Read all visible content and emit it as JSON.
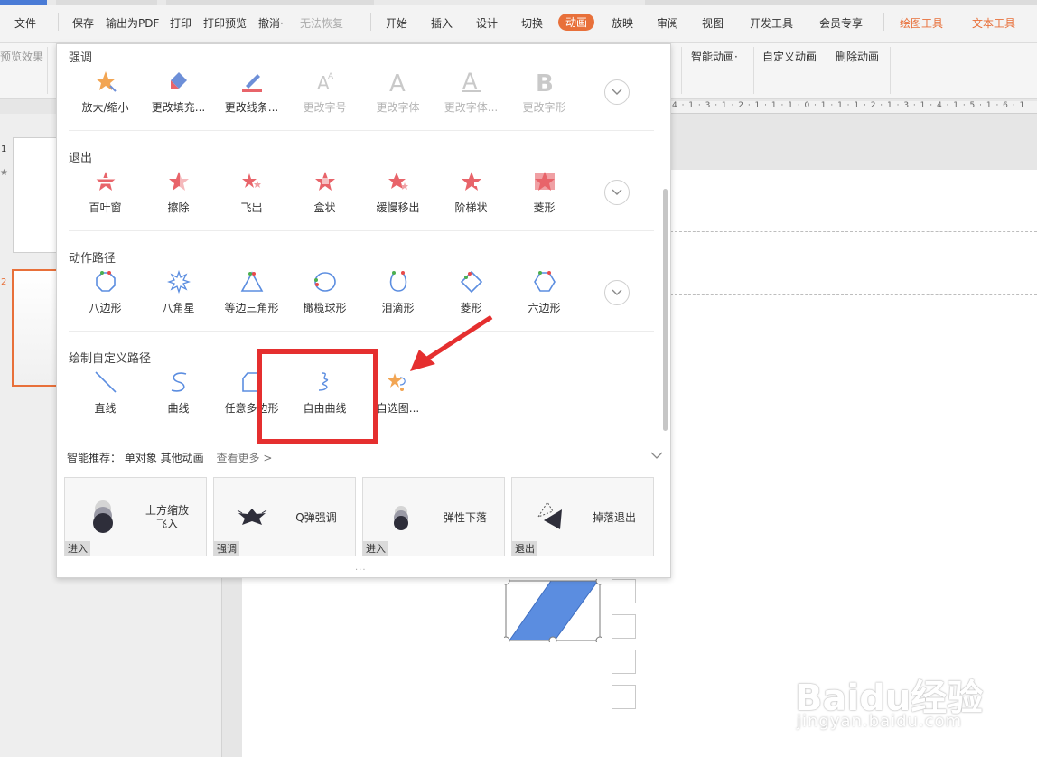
{
  "menubar": {
    "items": [
      {
        "label": "文件"
      },
      {
        "label": "保存"
      },
      {
        "label": "输出为PDF"
      },
      {
        "label": "打印"
      },
      {
        "label": "打印预览"
      },
      {
        "label": "撤消·"
      },
      {
        "label": "无法恢复"
      },
      {
        "label": "开始"
      },
      {
        "label": "插入"
      },
      {
        "label": "设计"
      },
      {
        "label": "切换"
      },
      {
        "label": "动画"
      },
      {
        "label": "放映"
      },
      {
        "label": "审阅"
      },
      {
        "label": "视图"
      },
      {
        "label": "开发工具"
      },
      {
        "label": "会员专享"
      },
      {
        "label": "绘图工具"
      },
      {
        "label": "文本工具"
      }
    ]
  },
  "ribbon": {
    "preview": "预览效果",
    "smart_anim": "智能动画·",
    "custom_anim": "自定义动画",
    "delete_anim": "删除动画"
  },
  "ruler": {
    "text": "4 · 1 · 3 · 1 · 2 · 1 · 1 · 1 · 0 · 1 · 1 · 1 · 2 · 1 · 3 · 1 · 4 · 1 · 5 · 1 · 6 · 1"
  },
  "slides": [
    {
      "num": "1",
      "star": "★"
    },
    {
      "num": "2"
    }
  ],
  "panel": {
    "sections": [
      {
        "title": "强调",
        "items": [
          {
            "label": "放大/缩小",
            "icon": "star-grow-icon",
            "enabled": true
          },
          {
            "label": "更改填充...",
            "icon": "fill-bucket-icon",
            "enabled": true
          },
          {
            "label": "更改线条...",
            "icon": "pen-line-icon",
            "enabled": true
          },
          {
            "label": "更改字号",
            "icon": "font-size-icon",
            "enabled": false
          },
          {
            "label": "更改字体",
            "icon": "font-a-icon",
            "enabled": false
          },
          {
            "label": "更改字体...",
            "icon": "font-underline-a-icon",
            "enabled": false
          },
          {
            "label": "更改字形",
            "icon": "font-bold-b-icon",
            "enabled": false
          }
        ]
      },
      {
        "title": "退出",
        "items": [
          {
            "label": "百叶窗",
            "icon": "star-blinds-icon",
            "enabled": true
          },
          {
            "label": "擦除",
            "icon": "star-wipe-icon",
            "enabled": true
          },
          {
            "label": "飞出",
            "icon": "star-flyout-icon",
            "enabled": true
          },
          {
            "label": "盒状",
            "icon": "star-box-icon",
            "enabled": true
          },
          {
            "label": "缓慢移出",
            "icon": "star-crawl-icon",
            "enabled": true
          },
          {
            "label": "阶梯状",
            "icon": "star-steps-icon",
            "enabled": true
          },
          {
            "label": "菱形",
            "icon": "star-diamond-icon",
            "enabled": true
          }
        ]
      },
      {
        "title": "动作路径",
        "items": [
          {
            "label": "八边形",
            "icon": "octagon-path-icon",
            "enabled": true
          },
          {
            "label": "八角星",
            "icon": "star8-path-icon",
            "enabled": true
          },
          {
            "label": "等边三角形",
            "icon": "triangle-path-icon",
            "enabled": true
          },
          {
            "label": "橄榄球形",
            "icon": "football-path-icon",
            "enabled": true
          },
          {
            "label": "泪滴形",
            "icon": "teardrop-path-icon",
            "enabled": true
          },
          {
            "label": "菱形",
            "icon": "diamond-path-icon",
            "enabled": true
          },
          {
            "label": "六边形",
            "icon": "hexagon-path-icon",
            "enabled": true
          }
        ]
      },
      {
        "title": "绘制自定义路径",
        "items": [
          {
            "label": "直线",
            "icon": "line-path-icon",
            "enabled": true
          },
          {
            "label": "曲线",
            "icon": "curve-path-icon",
            "enabled": true
          },
          {
            "label": "任意多边形",
            "icon": "freeform-polygon-icon",
            "enabled": true
          },
          {
            "label": "自由曲线",
            "icon": "scribble-path-icon",
            "enabled": true
          },
          {
            "label": "自选图...",
            "icon": "custom-shape-icon",
            "enabled": true
          }
        ]
      }
    ],
    "smart": {
      "title": "智能推荐：",
      "filter": "单对象 其他动画",
      "see_more": "查看更多 >"
    },
    "cards": [
      {
        "name": "上方缩放\n飞入",
        "tag": "进入",
        "icon": "zoom-fly-in-icon"
      },
      {
        "name": "Q弹强调",
        "tag": "强调",
        "icon": "bounce-emphasis-icon"
      },
      {
        "name": "弹性下落",
        "tag": "进入",
        "icon": "elastic-drop-icon"
      },
      {
        "name": "掉落退出",
        "tag": "退出",
        "icon": "drop-exit-icon"
      }
    ],
    "grip": "···"
  },
  "watermark": {
    "brand": "Baidu经验",
    "url": "jingyan.baidu.com"
  },
  "colors": {
    "accent": "#e8703a",
    "highlight": "#e52f2f",
    "shape_fill": "#5b8de0",
    "icon_red": "#e8646a"
  }
}
